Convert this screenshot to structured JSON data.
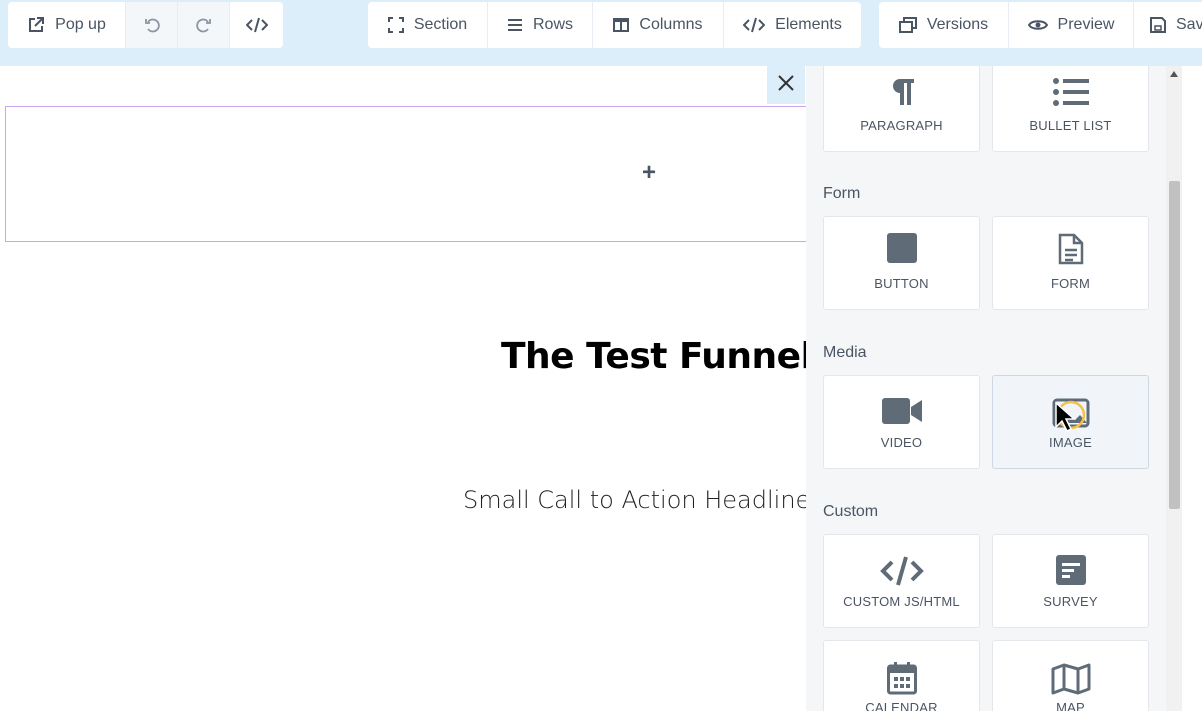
{
  "toolbar": {
    "popup_label": "Pop up",
    "section_label": "Section",
    "rows_label": "Rows",
    "columns_label": "Columns",
    "elements_label": "Elements",
    "versions_label": "Versions",
    "preview_label": "Preview",
    "save_label": "Save"
  },
  "canvas": {
    "add_symbol": "+",
    "headline": "The Test Funnel",
    "subheadline": "Small Call to Action Headline"
  },
  "panel": {
    "categories": {
      "form": "Form",
      "media": "Media",
      "custom": "Custom"
    },
    "tiles": {
      "paragraph": "Paragraph",
      "bullet_list": "Bullet List",
      "button": "Button",
      "form": "Form",
      "video": "Video",
      "image": "Image",
      "custom_js_html": "Custom JS/HTML",
      "survey": "Survey",
      "calendar": "Calendar",
      "map": "Map"
    }
  },
  "colors": {
    "toolbar_bg": "#ddeefb",
    "icon": "#5f6b76",
    "section_outline": "#c8a6ee",
    "highlight_ring": "#f2c14e"
  }
}
